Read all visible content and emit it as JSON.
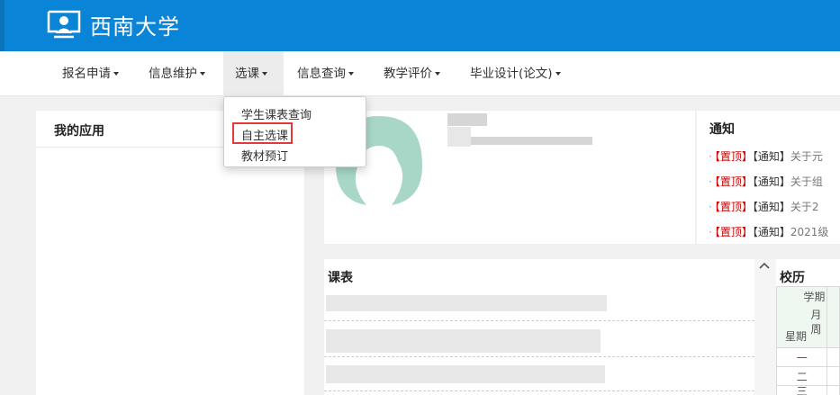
{
  "brand": {
    "name": "西南大学"
  },
  "nav": {
    "items": [
      {
        "label": "报名申请",
        "active": false
      },
      {
        "label": "信息维护",
        "active": false
      },
      {
        "label": "选课",
        "active": true
      },
      {
        "label": "信息查询",
        "active": false
      },
      {
        "label": "教学评价",
        "active": false
      },
      {
        "label": "毕业设计(论文)",
        "active": false
      }
    ]
  },
  "dropdown": {
    "items": [
      "学生课表查询",
      "自主选课",
      "教材预订"
    ],
    "highlighted": "自主选课",
    "highlight_color": "#e23a3a"
  },
  "apps_panel": {
    "title": "我的应用"
  },
  "notice_panel": {
    "title": "通知",
    "rows": [
      {
        "top": "【置顶】",
        "tag": "【通知】",
        "text": "关于元"
      },
      {
        "top": "【置顶】",
        "tag": "【通知】",
        "text": "关于组"
      },
      {
        "top": "【置顶】",
        "tag": "【通知】",
        "text": "关于2"
      },
      {
        "top": "【置顶】",
        "tag": "【通知】",
        "text": "2021级"
      }
    ]
  },
  "schedule_panel": {
    "title": "课表"
  },
  "calendar_panel": {
    "title": "校历",
    "header_term": "学期",
    "header_month": "月",
    "header_week": "周",
    "header_weekday": "星期",
    "weekdays": [
      "一",
      "二",
      "三"
    ]
  },
  "colors": {
    "header": "#0a84d6",
    "avatar": "#a8d7c8",
    "top_tag": "#cc0000"
  }
}
